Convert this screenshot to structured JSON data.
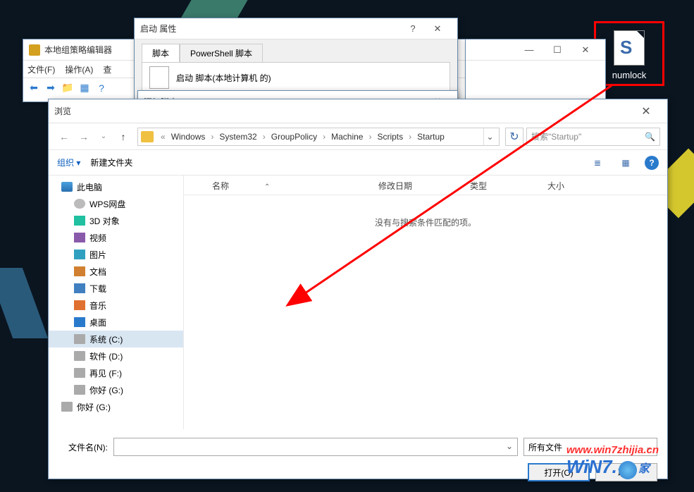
{
  "desktop_icon": {
    "label": "numlock"
  },
  "gpedit": {
    "title": "本地组策略编辑器",
    "menu": {
      "file": "文件(F)",
      "action": "操作(A)",
      "view": "查"
    }
  },
  "explorer_bg": {
    "min": "—",
    "max": "☐",
    "close": "✕"
  },
  "startup_prop": {
    "title": "启动 属性",
    "help": "?",
    "close": "✕",
    "tab1": "脚本",
    "tab2": "PowerShell 脚本",
    "script_label": "启动 脚本(本地计算机 的)"
  },
  "addscript": {
    "title": "添加脚本",
    "close": "✕"
  },
  "browse": {
    "title": "浏览",
    "close": "✕",
    "nav": {
      "back": "←",
      "forward": "→",
      "up": "↑",
      "sep": "«"
    },
    "breadcrumb": [
      "Windows",
      "System32",
      "GroupPolicy",
      "Machine",
      "Scripts",
      "Startup"
    ],
    "bc_dropdown": "⌄",
    "refresh": "↻",
    "search_placeholder": "搜索\"Startup\"",
    "toolbar": {
      "organize": "组织 ▾",
      "newfolder": "新建文件夹",
      "view_list": "≣",
      "view_details": "▦",
      "help": "?"
    },
    "sidebar": [
      {
        "label": "此电脑",
        "cls": "ti-computer",
        "sub": false
      },
      {
        "label": "WPS网盘",
        "cls": "ti-cloud",
        "sub": true
      },
      {
        "label": "3D 对象",
        "cls": "ti-3d",
        "sub": true
      },
      {
        "label": "视频",
        "cls": "ti-video",
        "sub": true
      },
      {
        "label": "图片",
        "cls": "ti-pictures",
        "sub": true
      },
      {
        "label": "文档",
        "cls": "ti-docs",
        "sub": true
      },
      {
        "label": "下载",
        "cls": "ti-downloads",
        "sub": true
      },
      {
        "label": "音乐",
        "cls": "ti-music",
        "sub": true
      },
      {
        "label": "桌面",
        "cls": "ti-desktop",
        "sub": true
      },
      {
        "label": "系统 (C:)",
        "cls": "ti-drive",
        "sub": true,
        "selected": true
      },
      {
        "label": "软件 (D:)",
        "cls": "ti-drive",
        "sub": true
      },
      {
        "label": "再见 (F:)",
        "cls": "ti-drive",
        "sub": true
      },
      {
        "label": "你好 (G:)",
        "cls": "ti-drive",
        "sub": true
      },
      {
        "label": "你好 (G:)",
        "cls": "ti-drive",
        "sub": false
      }
    ],
    "columns": {
      "name": "名称",
      "date": "修改日期",
      "type": "类型",
      "size": "大小"
    },
    "empty": "没有与搜索条件匹配的项。",
    "filename_label": "文件名(N):",
    "filename_value": "",
    "filter": "所有文件",
    "open": "打开(O)",
    "cancel": "取消"
  },
  "watermark": {
    "url": "www.win7zhijia.cn",
    "logo": "WiN7.",
    "jia": "家"
  }
}
